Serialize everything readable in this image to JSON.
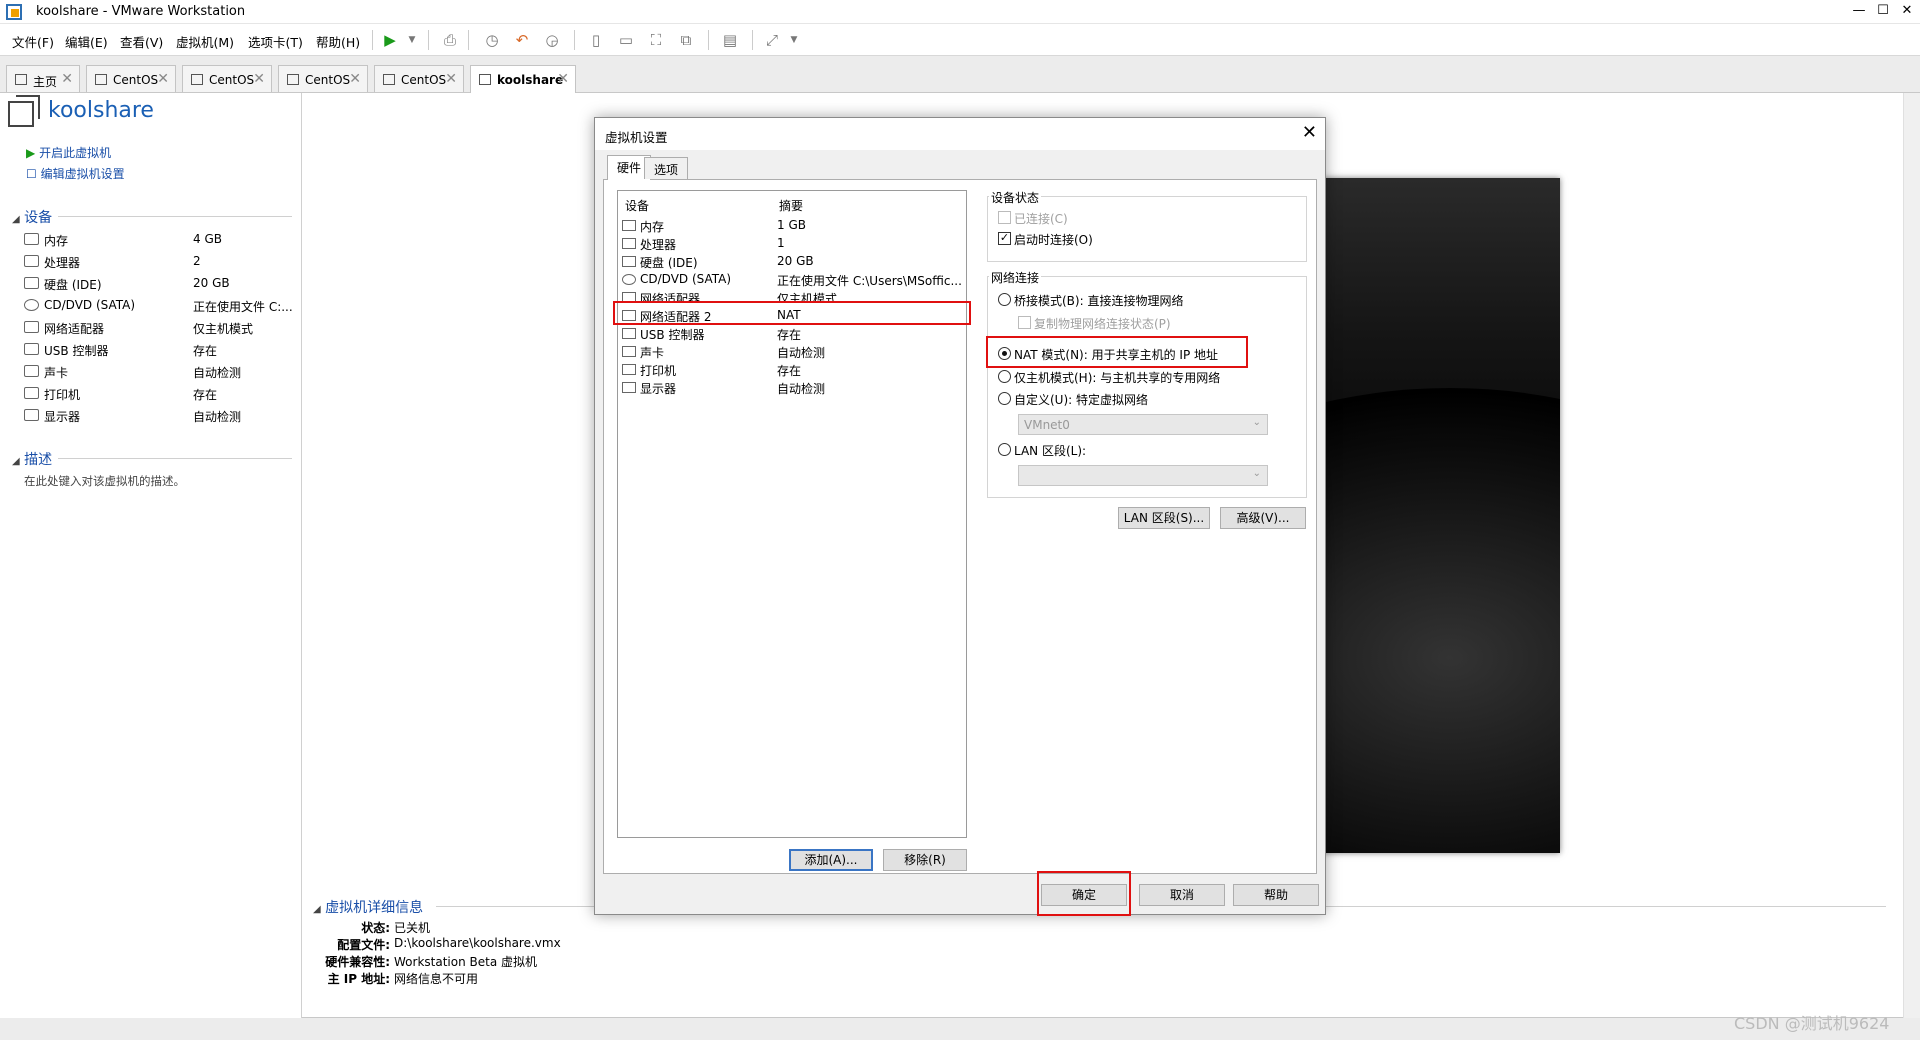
{
  "window": {
    "title": "koolshare - VMware Workstation",
    "minimize": "—",
    "maximize": "☐",
    "close": "✕"
  },
  "menu": [
    "文件(F)",
    "编辑(E)",
    "查看(V)",
    "虚拟机(M)",
    "选项卡(T)",
    "帮助(H)"
  ],
  "tabs": [
    {
      "label": "主页",
      "active": false
    },
    {
      "label": "CentOS",
      "active": false
    },
    {
      "label": "CentOS",
      "active": false
    },
    {
      "label": "CentOS",
      "active": false
    },
    {
      "label": "CentOS",
      "active": false
    },
    {
      "label": "koolshare",
      "active": true
    }
  ],
  "vm": {
    "name": "koolshare",
    "actions": [
      "开启此虚拟机",
      "编辑虚拟机设置"
    ],
    "devices_heading": "设备",
    "devices": [
      {
        "name": "内存",
        "value": "4 GB",
        "icon": "memory-icon"
      },
      {
        "name": "处理器",
        "value": "2",
        "icon": "cpu-icon"
      },
      {
        "name": "硬盘 (IDE)",
        "value": "20 GB",
        "icon": "harddisk-icon"
      },
      {
        "name": "CD/DVD (SATA)",
        "value": "正在使用文件 C:...",
        "icon": "cdrom-icon"
      },
      {
        "name": "网络适配器",
        "value": "仅主机模式",
        "icon": "network-icon"
      },
      {
        "name": "USB 控制器",
        "value": "存在",
        "icon": "usb-icon"
      },
      {
        "name": "声卡",
        "value": "自动检测",
        "icon": "sound-icon"
      },
      {
        "name": "打印机",
        "value": "存在",
        "icon": "printer-icon"
      },
      {
        "name": "显示器",
        "value": "自动检测",
        "icon": "display-icon"
      }
    ],
    "description_heading": "描述",
    "description_placeholder": "在此处键入对该虚拟机的描述。",
    "details_heading": "虚拟机详细信息",
    "details": [
      {
        "label": "状态:",
        "value": "已关机"
      },
      {
        "label": "配置文件:",
        "value": "D:\\koolshare\\koolshare.vmx"
      },
      {
        "label": "硬件兼容性:",
        "value": "Workstation Beta 虚拟机"
      },
      {
        "label": "主 IP 地址:",
        "value": "网络信息不可用"
      }
    ]
  },
  "dialog": {
    "title": "虚拟机设置",
    "close": "✕",
    "tabs": [
      "硬件",
      "选项"
    ],
    "list_headers": {
      "device": "设备",
      "summary": "摘要"
    },
    "rows": [
      {
        "name": "内存",
        "value": "1 GB"
      },
      {
        "name": "处理器",
        "value": "1"
      },
      {
        "name": "硬盘 (IDE)",
        "value": "20 GB"
      },
      {
        "name": "CD/DVD (SATA)",
        "value": "正在使用文件 C:\\Users\\MSoffic..."
      },
      {
        "name": "网络适配器",
        "value": "仅主机模式"
      },
      {
        "name": "网络适配器 2",
        "value": "NAT"
      },
      {
        "name": "USB 控制器",
        "value": "存在"
      },
      {
        "name": "声卡",
        "value": "自动检测"
      },
      {
        "name": "打印机",
        "value": "存在"
      },
      {
        "name": "显示器",
        "value": "自动检测"
      }
    ],
    "add_button": "添加(A)...",
    "remove_button": "移除(R)",
    "device_status": {
      "title": "设备状态",
      "connected": "已连接(C)",
      "connect_on_start": "启动时连接(O)"
    },
    "network": {
      "title": "网络连接",
      "bridged": "桥接模式(B): 直接连接物理网络",
      "replicate": "复制物理网络连接状态(P)",
      "nat": "NAT 模式(N): 用于共享主机的 IP 地址",
      "host_only": "仅主机模式(H): 与主机共享的专用网络",
      "custom": "自定义(U): 特定虚拟网络",
      "custom_value": "VMnet0",
      "lan": "LAN 区段(L):",
      "lan_value": ""
    },
    "lan_button": "LAN 区段(S)...",
    "advanced_button": "高级(V)...",
    "ok_button": "确定",
    "cancel_button": "取消",
    "help_button": "帮助"
  },
  "watermark": "CSDN @测试机9624",
  "colors": {
    "highlight": "#e01010",
    "link": "#1a4fa8"
  }
}
